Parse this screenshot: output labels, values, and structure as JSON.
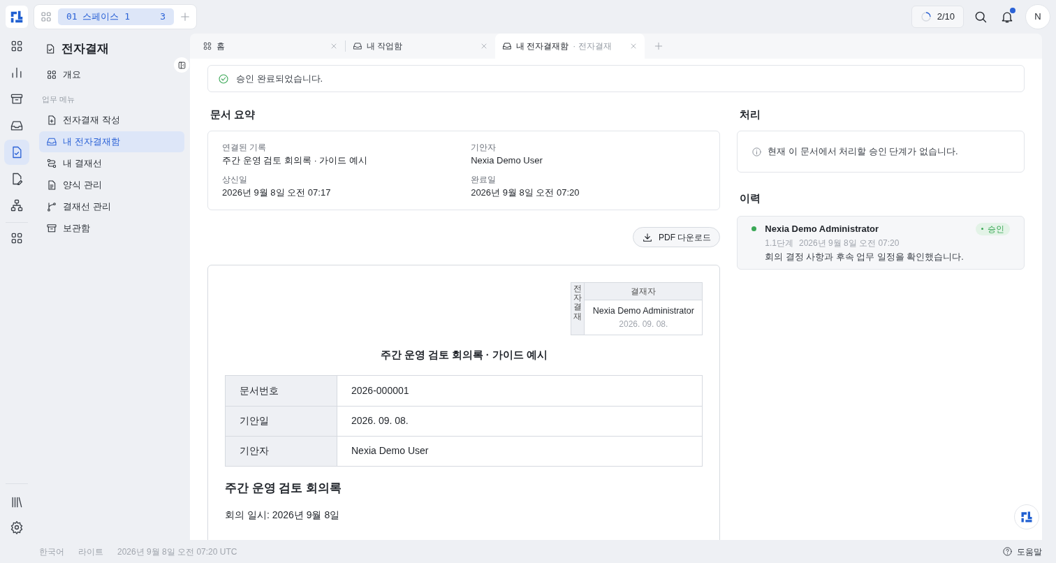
{
  "workspace": {
    "label": "01 스페이스 1",
    "count": "3"
  },
  "topbar": {
    "progress": "2/10",
    "notification_unread": true,
    "avatar": "N"
  },
  "rail": [
    {
      "selected": false
    },
    {
      "selected": false
    },
    {
      "selected": false
    },
    {
      "selected": false
    },
    {
      "selected": true
    },
    {
      "selected": false
    },
    {
      "selected": false
    },
    {
      "selected": false
    }
  ],
  "sidebar": {
    "title": "전자결재",
    "overview": {
      "label": "개요",
      "selected": false
    },
    "section": "업무 메뉴",
    "items": [
      {
        "label": "전자결재 작성",
        "selected": false
      },
      {
        "label": "내 전자결재함",
        "selected": true
      },
      {
        "label": "내 결재선",
        "selected": false
      },
      {
        "label": "양식 관리",
        "selected": false
      },
      {
        "label": "결재선 관리",
        "selected": false
      },
      {
        "label": "보관함",
        "selected": false
      }
    ]
  },
  "tabs": [
    {
      "label": "홈",
      "selected": false
    },
    {
      "label": "내 작업함",
      "selected": false
    },
    {
      "label": "내 전자결재함",
      "sublabel": "· 전자결재",
      "selected": true
    }
  ],
  "alert": "승인 완료되었습니다.",
  "summary": {
    "heading": "문서 요약",
    "fields": [
      {
        "label": "연결된 기록",
        "value": "주간 운영 검토 회의록 · 가이드 예시"
      },
      {
        "label": "기안자",
        "value": "Nexia Demo User"
      },
      {
        "label": "상신일",
        "value": "2026년 9월 8일 오전 07:17"
      },
      {
        "label": "완료일",
        "value": "2026년 9월 8일 오전 07:20"
      }
    ]
  },
  "pdf_button": "PDF 다운로드",
  "document": {
    "sign_box": {
      "side": "전자결재",
      "header": "결재자",
      "name": "Nexia Demo Administrator",
      "date": "2026. 09. 08."
    },
    "title": "주간 운영 검토 회의록 · 가이드 예시",
    "rows": [
      {
        "label": "문서번호",
        "value": "2026-000001"
      },
      {
        "label": "기안일",
        "value": "2026. 09. 08."
      },
      {
        "label": "기안자",
        "value": "Nexia Demo User"
      }
    ],
    "heading": "주간 운영 검토 회의록",
    "paragraph": "회의 일시: 2026년 9월 8일"
  },
  "process": {
    "heading": "처리",
    "notice": "현재 이 문서에서 처리할 승인 단계가 없습니다."
  },
  "history": {
    "heading": "이력",
    "entries": [
      {
        "name": "Nexia Demo Administrator",
        "status": "승인",
        "step": "1.1단계",
        "time": "2026년 9월 8일 오전 07:20",
        "comment": "회의 결정 사항과 후속 업무 일정을 확인했습니다.",
        "color": "#3aa856"
      }
    ]
  },
  "footer": {
    "language": "한국어",
    "theme": "라이트",
    "time": "2026년 9월 8일 오전 07:20 UTC",
    "help": "도움말"
  }
}
